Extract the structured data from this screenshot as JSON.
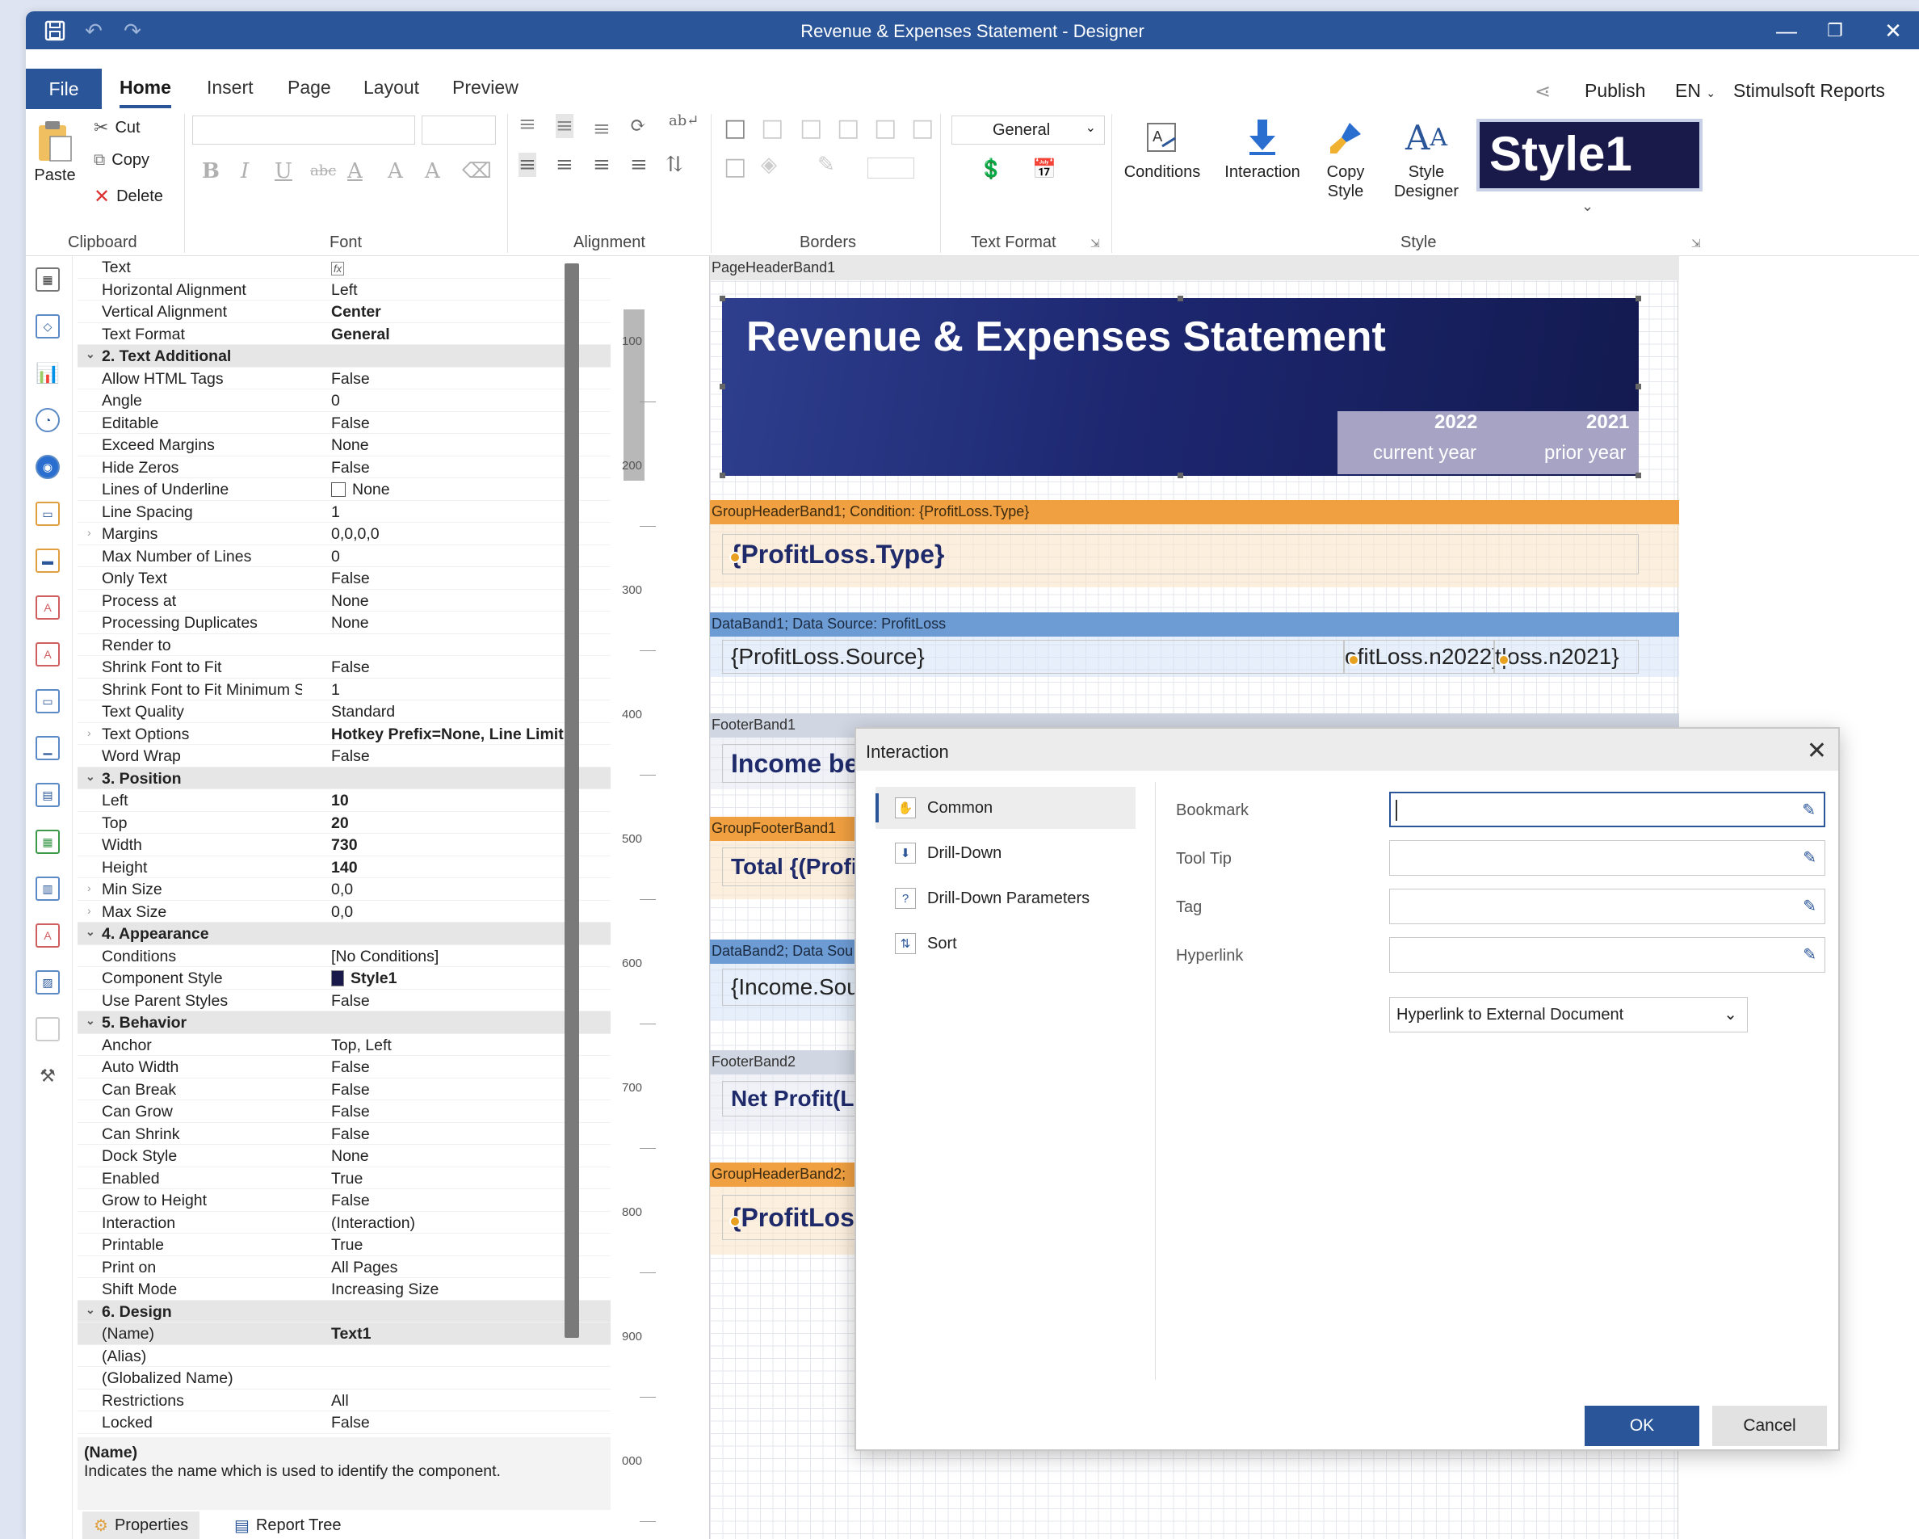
{
  "window": {
    "title": "Revenue & Expenses  Statement  - Designer"
  },
  "ribbon": {
    "tabs": [
      "File",
      "Home",
      "Insert",
      "Page",
      "Layout",
      "Preview"
    ],
    "right": {
      "publish": "Publish",
      "lang": "EN",
      "brand": "Stimulsoft Reports"
    },
    "clipboard": {
      "paste": "Paste",
      "cut": "Cut",
      "copy": "Copy",
      "delete": "Delete",
      "group": "Clipboard"
    },
    "groups": {
      "font": "Font",
      "alignment": "Alignment",
      "borders": "Borders",
      "text_format": "Text Format",
      "style": "Style"
    },
    "text_format_value": "General",
    "buttons": {
      "conditions": "Conditions",
      "interaction": "Interaction",
      "copy_style_1": "Copy",
      "copy_style_2": "Style",
      "style_designer_1": "Style",
      "style_designer_2": "Designer"
    },
    "style_preview": "Style1"
  },
  "properties": {
    "rows": [
      {
        "k": "Text",
        "v": ""
      },
      {
        "k": "Horizontal Alignment",
        "v": "Left"
      },
      {
        "k": "Vertical Alignment",
        "v": "Center"
      },
      {
        "k": "Text Format",
        "v": "General"
      },
      {
        "k": "2. Text  Additional",
        "cat": true
      },
      {
        "k": "Allow HTML Tags",
        "v": "False"
      },
      {
        "k": "Angle",
        "v": "0"
      },
      {
        "k": "Editable",
        "v": "False"
      },
      {
        "k": "Exceed Margins",
        "v": "None"
      },
      {
        "k": "Hide Zeros",
        "v": "False"
      },
      {
        "k": "Lines of Underline",
        "v": "None"
      },
      {
        "k": "Line Spacing",
        "v": "1"
      },
      {
        "k": "Margins",
        "v": "0,0,0,0"
      },
      {
        "k": "Max Number of Lines",
        "v": "0"
      },
      {
        "k": "Only Text",
        "v": "False"
      },
      {
        "k": "Process at",
        "v": "None"
      },
      {
        "k": "Processing Duplicates",
        "v": "None"
      },
      {
        "k": "Render to",
        "v": ""
      },
      {
        "k": "Shrink Font to Fit",
        "v": "False"
      },
      {
        "k": "Shrink Font to Fit Minimum Size",
        "v": "1"
      },
      {
        "k": "Text Quality",
        "v": "Standard"
      },
      {
        "k": "Text Options",
        "v": "Hotkey Prefix=None, Line Limit"
      },
      {
        "k": "Word Wrap",
        "v": "False"
      },
      {
        "k": "3. Position",
        "cat": true
      },
      {
        "k": "Left",
        "v": "10"
      },
      {
        "k": "Top",
        "v": "20"
      },
      {
        "k": "Width",
        "v": "730"
      },
      {
        "k": "Height",
        "v": "140"
      },
      {
        "k": "Min Size",
        "v": "0,0"
      },
      {
        "k": "Max Size",
        "v": "0,0"
      },
      {
        "k": "4. Appearance",
        "cat": true
      },
      {
        "k": "Conditions",
        "v": "[No Conditions]"
      },
      {
        "k": "Component Style",
        "v": "Style1"
      },
      {
        "k": "Use Parent Styles",
        "v": "False"
      },
      {
        "k": "5. Behavior",
        "cat": true
      },
      {
        "k": "Anchor",
        "v": "Top, Left"
      },
      {
        "k": "Auto Width",
        "v": "False"
      },
      {
        "k": "Can Break",
        "v": "False"
      },
      {
        "k": "Can Grow",
        "v": "False"
      },
      {
        "k": "Can Shrink",
        "v": "False"
      },
      {
        "k": "Dock Style",
        "v": "None"
      },
      {
        "k": "Enabled",
        "v": "True"
      },
      {
        "k": "Grow to Height",
        "v": "False"
      },
      {
        "k": "Interaction",
        "v": "(Interaction)"
      },
      {
        "k": "Printable",
        "v": "True"
      },
      {
        "k": "Print on",
        "v": "All Pages"
      },
      {
        "k": "Shift Mode",
        "v": "Increasing Size"
      },
      {
        "k": "6. Design",
        "cat": true
      },
      {
        "k": "(Name)",
        "v": "Text1"
      },
      {
        "k": "(Alias)",
        "v": ""
      },
      {
        "k": "(Globalized Name)",
        "v": ""
      },
      {
        "k": "Restrictions",
        "v": "All"
      },
      {
        "k": "Locked",
        "v": "False"
      }
    ],
    "desc_title": "(Name)",
    "desc_text": "Indicates the name which is used to identify the component.",
    "tab_properties": "Properties",
    "tab_report_tree": "Report Tree"
  },
  "ruler": [
    "100",
    "200",
    "300",
    "400",
    "500",
    "600",
    "700",
    "800",
    "900",
    "000"
  ],
  "report": {
    "page_header_band": "PageHeaderBand1",
    "title": "Revenue & Expenses Statement",
    "year1": "2022",
    "year1_sub": "current year",
    "year2": "2021",
    "year2_sub": "prior year",
    "group_header1": "GroupHeaderBand1; Condition: {ProfitLoss.Type}",
    "group_header1_text": "{ProfitLoss.Type}",
    "data_band1": "DataBand1; Data Source: ProfitLoss",
    "data_source_text": "{ProfitLoss.Source}",
    "data_n2022": "ofitLoss.n2022}",
    "data_n2021": "t|oss.n2021}",
    "footer_band1": "FooterBand1",
    "footer1_text": "Income be",
    "group_footer1": "GroupFooterBand1",
    "group_footer1_text": "Total {(Profi",
    "data_band2": "DataBand2; Data Sou",
    "data_band2_text": "{Income.Sou",
    "footer_band2": "FooterBand2",
    "footer2_text": "Net Profit(Lo",
    "group_header2": "GroupHeaderBand2;",
    "group_header2_text": "{ProfitLoss"
  },
  "dialog": {
    "title": "Interaction",
    "nav": [
      "Common",
      "Drill-Down",
      "Drill-Down Parameters",
      "Sort"
    ],
    "fields": {
      "bookmark": "Bookmark",
      "tooltip": "Tool Tip",
      "tag": "Tag",
      "hyperlink": "Hyperlink"
    },
    "hyperlink_type": "Hyperlink to External Document",
    "ok": "OK",
    "cancel": "Cancel"
  }
}
